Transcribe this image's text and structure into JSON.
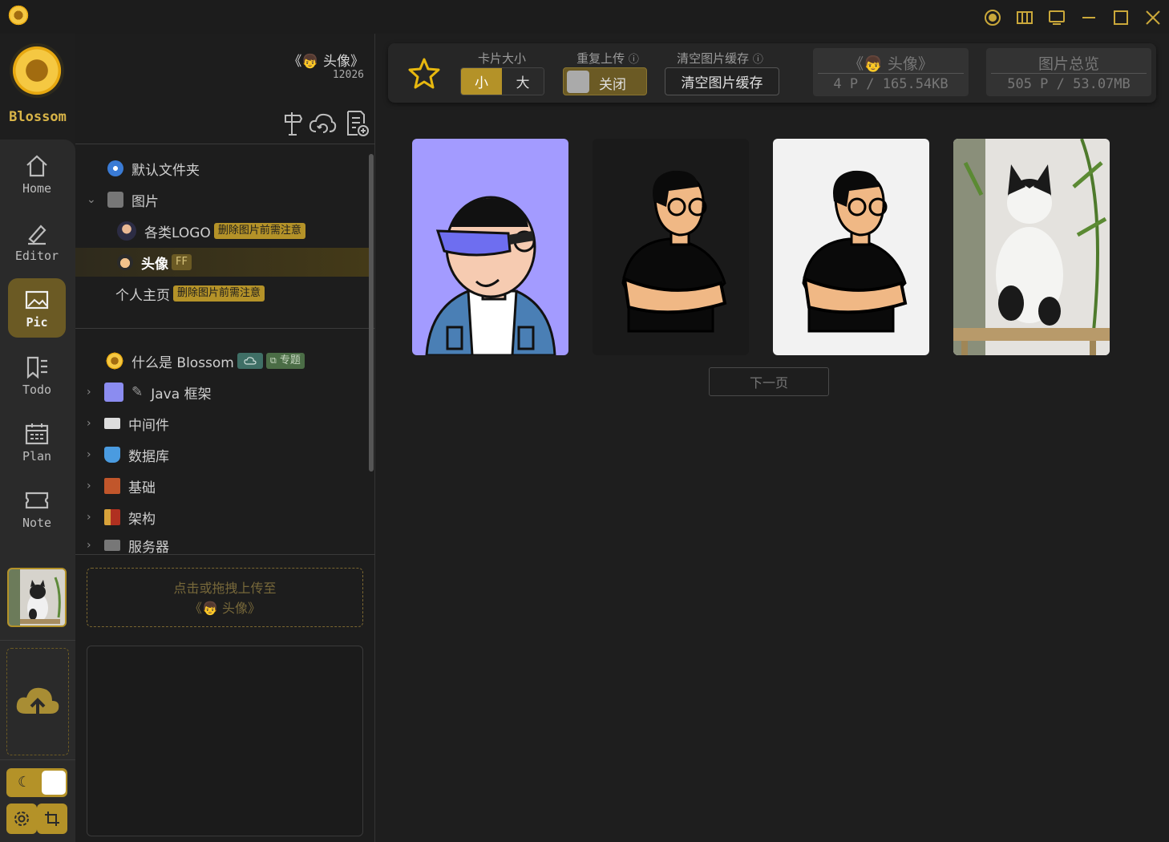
{
  "app": {
    "name": "Blossom"
  },
  "nav": {
    "items": [
      {
        "label": "Home"
      },
      {
        "label": "Editor"
      },
      {
        "label": "Pic"
      },
      {
        "label": "Todo"
      },
      {
        "label": "Plan"
      },
      {
        "label": "Note"
      }
    ]
  },
  "folder_header": {
    "title": "《👦 头像》",
    "count": "12026"
  },
  "tree": {
    "group1": [
      {
        "label": "默认文件夹",
        "icon": "blue-circle-icon"
      },
      {
        "label": "图片",
        "icon": "camera-icon"
      },
      {
        "label": "各类LOGO",
        "badge": "删除图片前需注意",
        "icon": "avatar-icon"
      },
      {
        "label": "头像",
        "badge": "FF",
        "icon": "avatar-icon"
      },
      {
        "label": "个人主页",
        "badge": "删除图片前需注意"
      }
    ],
    "group2": [
      {
        "label": "什么是 Blossom",
        "badge": "专题",
        "icon": "flower-icon"
      },
      {
        "label": "Java 框架",
        "icon": "avatar-icon"
      },
      {
        "label": "中间件",
        "icon": "laptop-icon"
      },
      {
        "label": "数据库",
        "icon": "bucket-icon"
      },
      {
        "label": "基础",
        "icon": "brick-icon"
      },
      {
        "label": "架构",
        "icon": "crane-icon"
      },
      {
        "label": "服务器",
        "icon": "desktop-icon"
      }
    ]
  },
  "upload": {
    "line1": "点击或拖拽上传至",
    "line2": "《👦 头像》"
  },
  "topbar": {
    "card_size_label": "卡片大小",
    "size_small": "小",
    "size_large": "大",
    "repeat_upload_label": "重复上传",
    "repeat_upload_state": "关闭",
    "clear_cache_label": "清空图片缓存",
    "clear_cache_button": "清空图片缓存",
    "folder_title": "《👦 头像》",
    "folder_stats": "4 P / 165.54KB",
    "overview_title": "图片总览",
    "overview_stats": "505 P / 53.07MB"
  },
  "gallery": {
    "cards": [
      {
        "name": "vr-avatar",
        "bg": "#a39bff"
      },
      {
        "name": "cartoon-man-dark",
        "bg": "#1a1a1a"
      },
      {
        "name": "cartoon-man-light",
        "bg": "#f2f2f2"
      },
      {
        "name": "cat-photo",
        "bg": "#c8c5bf"
      }
    ],
    "next_page": "下一页"
  },
  "colors": {
    "accent": "#b49228",
    "bg": "#1e1e1e",
    "panel": "#262626"
  }
}
